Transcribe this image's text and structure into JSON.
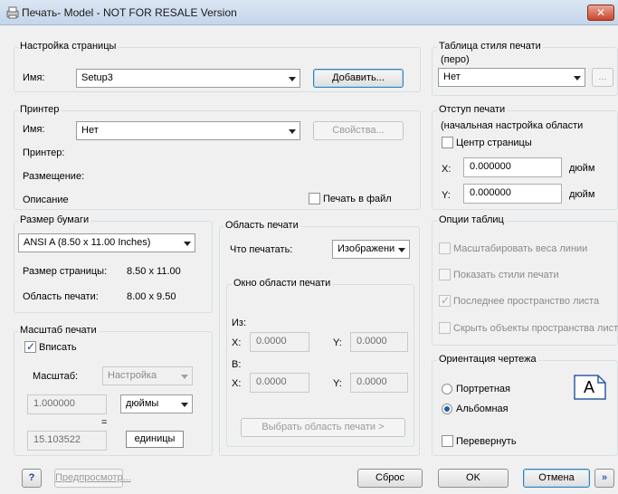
{
  "window": {
    "title": "Печать- Model - NOT FOR RESALE Version",
    "close_label": "✕"
  },
  "page_setup": {
    "group_title": "Настройка страницы",
    "name_label": "Имя:",
    "name_value": "Setup3",
    "add_button": "Добавить..."
  },
  "printer": {
    "group_title": "Принтер",
    "name_label": "Имя:",
    "name_value": "Нет",
    "properties_button": "Свойства...",
    "printer_label": "Принтер:",
    "location_label": "Размещение:",
    "description_label": "Описание",
    "print_to_file_label": "Печать в файл",
    "print_to_file_checked": false
  },
  "paper_size": {
    "group_title": "Размер бумаги",
    "value": "ANSI A (8.50 x 11.00 Inches)",
    "page_size_label": "Размер страницы:",
    "page_size_value": "8.50 x 11.00",
    "print_area_label": "Область печати:",
    "print_area_value": "8.00 x 9.50"
  },
  "print_scale": {
    "group_title": "Масштаб печати",
    "fit_label": "Вписать",
    "fit_checked": true,
    "scale_label": "Масштаб:",
    "scale_value": "Настройка",
    "value1": "1.000000",
    "unit1": "дюймы",
    "equals": "=",
    "value2": "15.103522",
    "unit2": "единицы"
  },
  "print_area": {
    "group_title": "Область печати",
    "what_label": "Что печатать:",
    "what_value": "Изображени",
    "window_group_title": "Окно области печати",
    "from_label": "Из:",
    "from_x_label": "X:",
    "from_x_value": "0.0000",
    "from_y_label": "Y:",
    "from_y_value": "0.0000",
    "to_label": "В:",
    "to_x_label": "X:",
    "to_x_value": "0.0000",
    "to_y_label": "Y:",
    "to_y_value": "0.0000",
    "select_button": "Выбрать область печати >"
  },
  "plot_style": {
    "group_title_line1": "Таблица стиля печати",
    "group_title_line2": "(перо)",
    "value": "Нет",
    "edit_button": "..."
  },
  "plot_offset": {
    "group_title_line1": "Отступ печати",
    "group_title_line2": "(начальная настройка области",
    "center_label": "Центр страницы",
    "center_checked": false,
    "x_label": "X:",
    "x_value": "0.000000",
    "x_unit": "дюйм",
    "y_label": "Y:",
    "y_value": "0.000000",
    "y_unit": "дюйм"
  },
  "table_options": {
    "group_title": "Опции таблиц",
    "options": [
      {
        "label": "Масштабировать веса линии",
        "checked": false
      },
      {
        "label": "Показать стили печати",
        "checked": false
      },
      {
        "label": "Последнее пространство листа",
        "checked": true
      },
      {
        "label": "Скрыть объекты пространства лист",
        "checked": false
      }
    ]
  },
  "orientation": {
    "group_title": "Ориентация чертежа",
    "portrait_label": "Портретная",
    "landscape_label": "Альбомная",
    "selected": "landscape",
    "flip_label": "Перевернуть",
    "flip_checked": false,
    "preview_letter": "A"
  },
  "footer": {
    "help_label": "?",
    "preview_button": "Предпросмотр...",
    "reset_button": "Сброс",
    "ok_button": "OK",
    "cancel_button": "Отмена",
    "expand_button": "»"
  }
}
